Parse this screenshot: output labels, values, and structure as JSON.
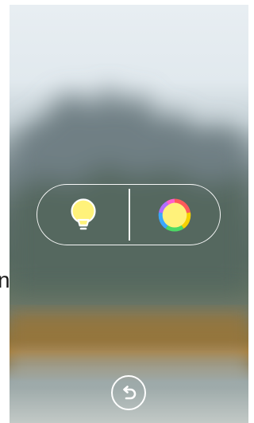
{
  "edge_text": "n",
  "controls": {
    "left_icon": "lightbulb-icon",
    "right_icon": "color-wheel-icon",
    "bulb_color": "#fff27a",
    "wheel_colors": [
      "#ff5a5a",
      "#f6d200",
      "#4cd964",
      "#3aa8ff",
      "#b36cff",
      "#ff5ecf"
    ]
  },
  "back_icon": "undo-icon"
}
